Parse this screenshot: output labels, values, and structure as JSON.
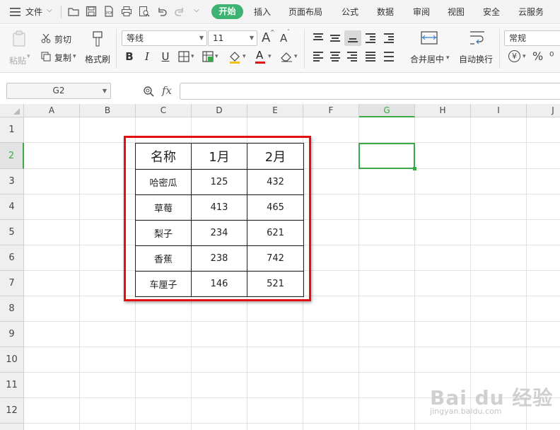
{
  "menubar": {
    "file_label": "文件",
    "tabs": [
      "开始",
      "插入",
      "页面布局",
      "公式",
      "数据",
      "审阅",
      "视图",
      "安全",
      "云服务"
    ]
  },
  "ribbon": {
    "paste_label": "粘贴",
    "cut_label": "剪切",
    "copy_label": "复制",
    "format_painter_label": "格式刷",
    "font_name": "等线",
    "font_size": "11",
    "merge_center_label": "合并居中",
    "wrap_text_label": "自动换行",
    "number_format": "常规",
    "bold": "B",
    "italic": "I",
    "underline": "U",
    "grow_font": "A",
    "shrink_font": "A",
    "font_color": "A",
    "currency_symbol": "¥",
    "percent_symbol": "%"
  },
  "formula_bar": {
    "cell_ref": "G2",
    "fx_label": "fx",
    "formula": ""
  },
  "sheet": {
    "columns": [
      "A",
      "B",
      "C",
      "D",
      "E",
      "F",
      "G",
      "H",
      "I",
      "J"
    ],
    "active_column": "G",
    "rows": [
      "1",
      "2",
      "3",
      "4",
      "5",
      "6",
      "7",
      "8",
      "9",
      "10",
      "11",
      "12"
    ],
    "active_row": "2"
  },
  "table": {
    "headers": [
      "名称",
      "1月",
      "2月"
    ],
    "rows": [
      [
        "哈密瓜",
        "125",
        "432"
      ],
      [
        "草莓",
        "413",
        "465"
      ],
      [
        "梨子",
        "234",
        "621"
      ],
      [
        "香蕉",
        "238",
        "742"
      ],
      [
        "车厘子",
        "146",
        "521"
      ]
    ]
  },
  "watermark": {
    "main": "Bai du 经验",
    "sub": "jingyan.baidu.com"
  },
  "colors": {
    "accent": "#3cb371",
    "selection": "#3aa846",
    "highlight_box": "#e60f0f"
  }
}
